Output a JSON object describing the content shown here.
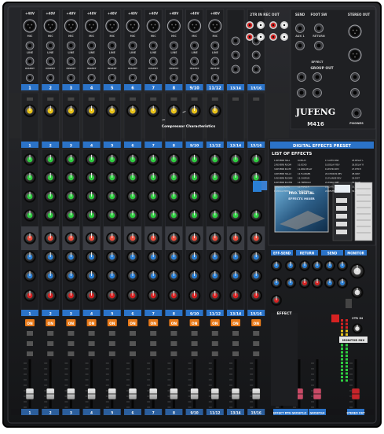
{
  "brand": {
    "logo_text": "JUFENG",
    "model": "M416"
  },
  "top_labels": {
    "phantom": "+48V",
    "mic": "MIC",
    "line": "LINE",
    "insert": "INSERT",
    "send": "SEND",
    "aux": "AUX 1",
    "return": "RETURN",
    "foot_sw": "FOOT SW",
    "two_tr_rec": "2TR IN  REC OUT",
    "stereo_out": "STEREO OUT",
    "group_out": "GROUP OUT",
    "effect": "EFFECT",
    "phones": "PHONES",
    "compressor": "Compressor Characteristics"
  },
  "channel_labels": [
    "1",
    "2",
    "3",
    "4",
    "5",
    "6",
    "7",
    "8",
    "9/10",
    "11/12",
    "13/14",
    "15/16"
  ],
  "channel_labels_short": [
    "1",
    "2",
    "3",
    "4",
    "5",
    "6",
    "7",
    "8",
    "9/10",
    "11/12"
  ],
  "effects": {
    "panel_title": "DIGITAL EFFECTS PRESET",
    "list_title": "LIST OF EFFECTS",
    "items": [
      "1.REVERB HALL",
      "2.REVERB ROOM",
      "3.REVERB PLATE",
      "4.REVERB HALL2",
      "5.REVERB ROOM2",
      "6.REVERB PLATE2",
      "7.VOCAL PLATE",
      "8.VOCAL ECHO",
      "9.DELAY",
      "10.ECHO",
      "11.PAN DELAY",
      "12.FLANGER",
      "13.CHORUS",
      "14.TREMOLO",
      "15.PHASER",
      "16.ROTARY",
      "17.AUTO PAN",
      "18.DELAY REV",
      "19.ECHO REV",
      "20.CHORUS REV",
      "21.FLANGE REV",
      "22.EARLY REF",
      "23.GATE REV",
      "24.REVERSE",
      "25.DELAY L",
      "26.DELAY R",
      "27.PITCH",
      "28.WAH",
      "29.DIST",
      "30.SLAP",
      "31.VOICE",
      "32.AMBIENCE"
    ],
    "screen_line1": "PRO. DIGITAL",
    "screen_line2": "EFFECTS MIXER",
    "effect_label": "EFFECT"
  },
  "section_labels": {
    "eff_send": "EFF-SEND",
    "return": "RETURN",
    "send": "SEND",
    "monitor": "MONITOR",
    "two_tr_in": "2TR IN",
    "monitor_mix": "MONITOR MIX",
    "stereo_out": "STEREO OUT"
  },
  "fader_labels": [
    "1",
    "2",
    "3",
    "4",
    "5",
    "6",
    "7",
    "8",
    "9/10",
    "11/12",
    "13/14",
    "15/16",
    "EFFECT RTN",
    "GROUP1/2",
    "GROUP3/4",
    "STEREO OUT"
  ],
  "on_label": "ON",
  "colors": {
    "body": "#1c1d20",
    "green": "#2ecc40",
    "red": "#d62222",
    "blue": "#2a7fd4",
    "yellow": "#e8c21a",
    "channel_strip_blue": "#2b73c8",
    "orange": "#e87a1a"
  }
}
